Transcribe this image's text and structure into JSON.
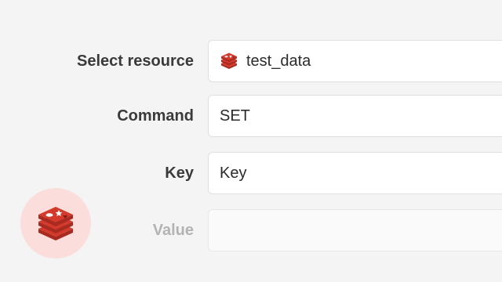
{
  "form": {
    "resource": {
      "label": "Select resource",
      "value": "test_data",
      "icon": "redis-icon"
    },
    "command": {
      "label": "Command",
      "value": "SET"
    },
    "key": {
      "label": "Key",
      "value": "Key"
    },
    "value": {
      "label": "Value",
      "value": ""
    }
  },
  "logo": {
    "icon": "redis-logo",
    "background": "#fbdedc"
  },
  "colors": {
    "brand": "#d33a2c",
    "brand_dark": "#a82a20",
    "label": "#3a3a3a",
    "label_disabled": "#b3b3b3"
  }
}
